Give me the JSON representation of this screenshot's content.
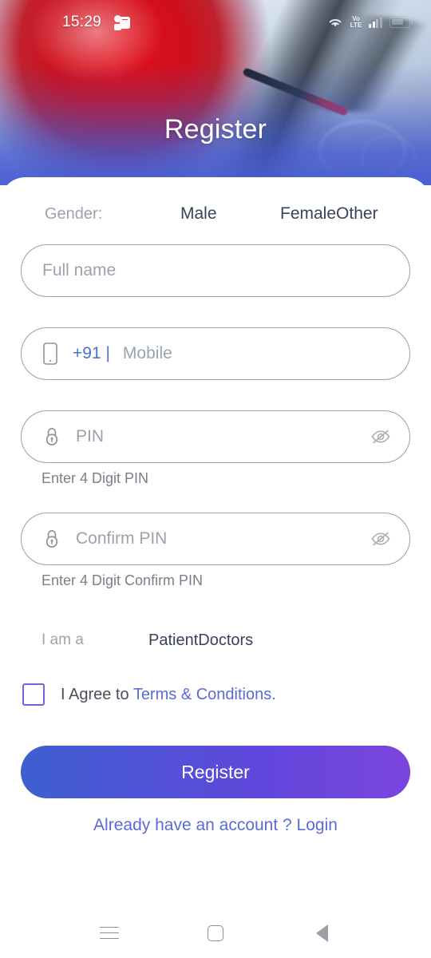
{
  "status_bar": {
    "time": "15:29",
    "notification_icon": "teams-icon",
    "wifi_icon": "wifi-icon",
    "volte_label_top": "Vo",
    "volte_label_bottom": "LTE",
    "signal_icon": "signal-bars-icon",
    "battery_icon": "battery-icon"
  },
  "hero": {
    "title": "Register"
  },
  "gender": {
    "label": "Gender:",
    "options": [
      "Male",
      "Female",
      "Other"
    ]
  },
  "fields": {
    "full_name": {
      "placeholder": "Full name"
    },
    "mobile": {
      "icon": "smartphone-icon",
      "country_code": "+91 |",
      "placeholder": "Mobile"
    },
    "pin": {
      "icon": "lock-icon",
      "placeholder": "PIN",
      "toggle_icon": "eye-off-icon",
      "helper": "Enter 4 Digit PIN"
    },
    "confirm_pin": {
      "icon": "lock-icon",
      "placeholder": "Confirm PIN",
      "toggle_icon": "eye-off-icon",
      "helper": "Enter 4 Digit Confirm PIN"
    }
  },
  "role": {
    "label": "I am  a",
    "options": [
      "Patient",
      "Doctors"
    ]
  },
  "terms": {
    "checked": false,
    "prefix": "I Agree to ",
    "link": "Terms & Conditions."
  },
  "actions": {
    "register_label": "Register",
    "login_label": "Already have an account ? Login"
  },
  "nav_bar": {
    "recents": "recents-icon",
    "home": "home-icon",
    "back": "back-icon"
  },
  "colors": {
    "accent_blue": "#3f5fd0",
    "accent_purple": "#7b45de",
    "link": "#5a6bd8",
    "checkbox_border": "#7b61d9",
    "placeholder": "#9aa3ae",
    "option_text": "#39415c",
    "helper_text": "#7a7f88",
    "field_border": "#9b9fa6"
  }
}
